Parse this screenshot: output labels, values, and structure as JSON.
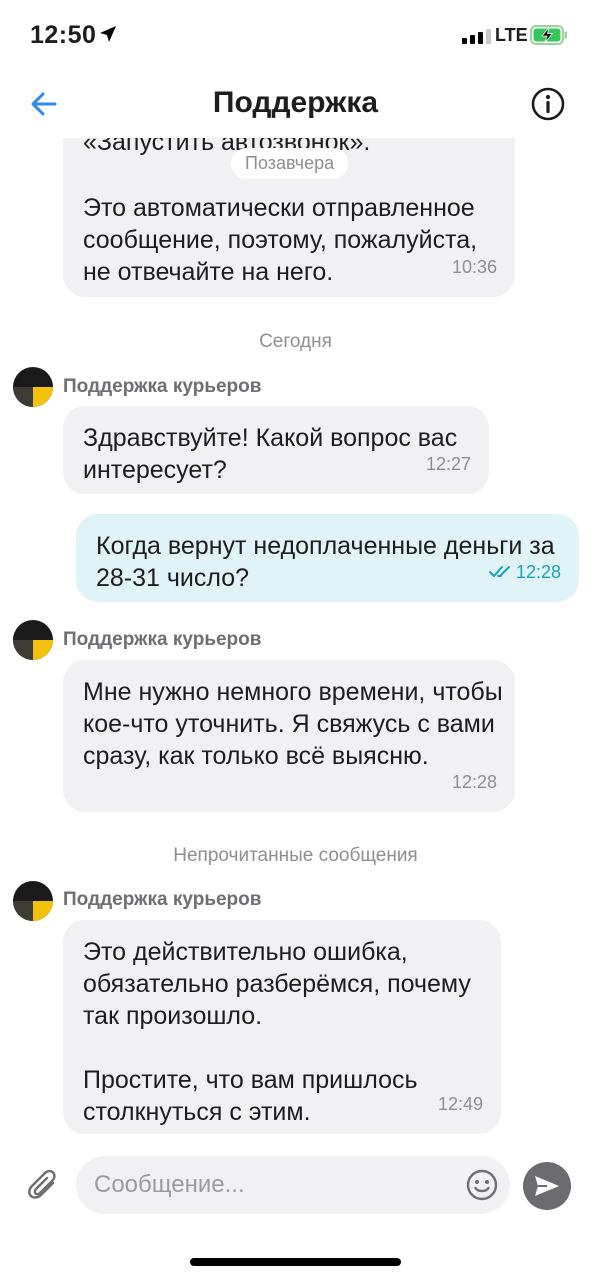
{
  "status_bar": {
    "time": "12:50",
    "network": "LTE",
    "battery_icon": "battery-charging-icon",
    "location_icon": "location-arrow-icon"
  },
  "header": {
    "title": "Поддержка",
    "back_icon": "arrow-left-icon",
    "info_icon": "info-icon"
  },
  "messages": [
    {
      "direction": "in",
      "text": "«Запустить автозвонок».",
      "time": ""
    },
    {
      "direction": "in",
      "text": "Это автоматически отправленное сообщение, поэтому, пожалуйста, не отвечайте на него.",
      "time": "10:36"
    },
    {
      "direction": "in",
      "sender": "Поддержка курьеров",
      "text": "Здравствуйте! Какой вопрос вас интересует?",
      "time": "12:27"
    },
    {
      "direction": "out",
      "text": "Когда вернут недоплаченные деньги за 28-31 число?",
      "time": "12:28",
      "status_icon": "double-check-icon"
    },
    {
      "direction": "in",
      "sender": "Поддержка курьеров",
      "text": "Мне нужно немного времени, чтобы кое-что уточнить. Я свяжусь с вами сразу, как только всё выясню.",
      "time": "12:28"
    },
    {
      "direction": "in",
      "sender": "Поддержка курьеров",
      "text": "Это действительно ошибка, обязательно разберёмся, почему так произошло.\n\nПростите, что вам пришлось столкнуться с этим.",
      "time": "12:49"
    }
  ],
  "separators": {
    "date_pill": "Позавчера",
    "today": "Сегодня",
    "unread": "Непрочитанные сообщения"
  },
  "composer": {
    "placeholder": "Сообщение...",
    "attach_icon": "paperclip-icon",
    "emoji_icon": "smiley-icon",
    "send_icon": "send-arrow-icon"
  },
  "colors": {
    "accent": "#2a8be8",
    "incoming_bubble": "#f1f1f4",
    "outgoing_bubble": "#e0f3f7",
    "outgoing_time": "#1aa3b8"
  }
}
